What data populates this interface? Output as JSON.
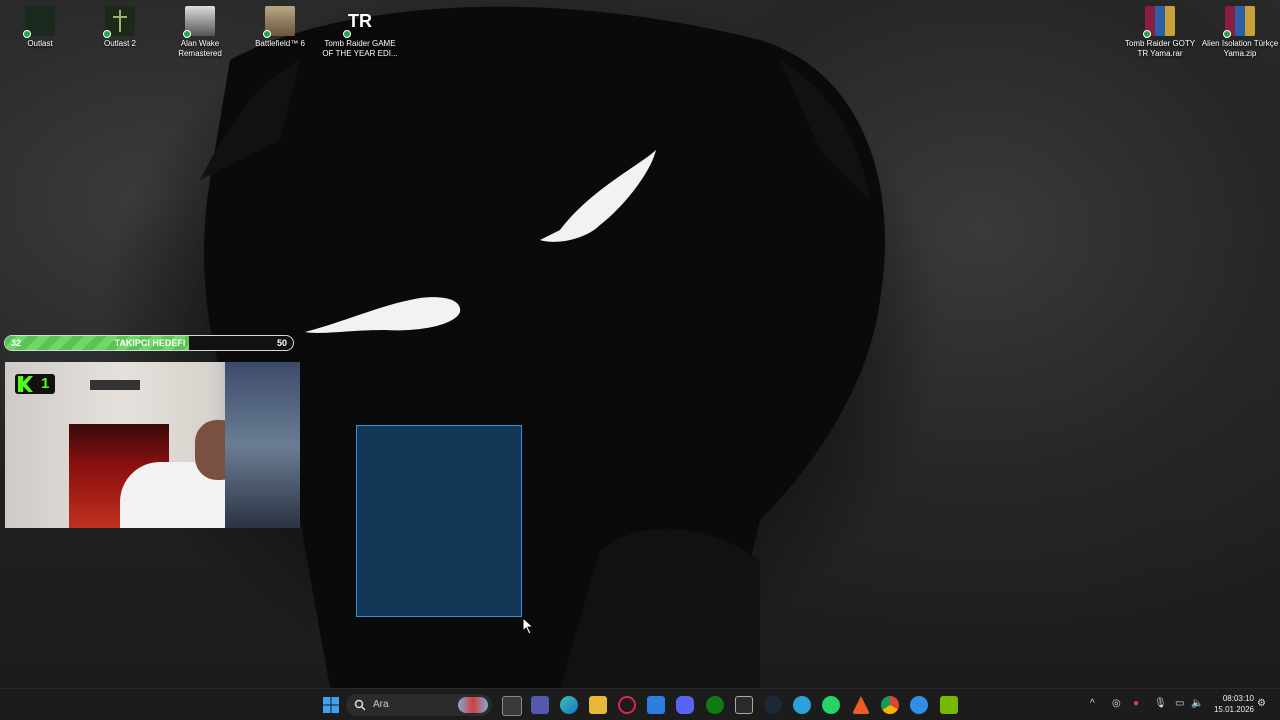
{
  "desktop_icons_left": [
    {
      "label": "Outlast",
      "icon": "outlast-icon"
    },
    {
      "label": "Outlast 2",
      "icon": "outlast-2-icon"
    },
    {
      "label": "Alan Wake Remastered",
      "icon": "alan-wake-icon"
    },
    {
      "label": "Battlefield™ 6",
      "icon": "battlefield-icon"
    },
    {
      "label": "Tomb Raider GAME OF THE YEAR EDI...",
      "icon": "tomb-raider-icon",
      "glyph": "TR"
    }
  ],
  "desktop_icons_right": [
    {
      "label": "Tomb Raider GOTY TR Yama.rar",
      "icon": "winrar-archive-icon"
    },
    {
      "label": "Alien Isolation Türkçe Yama.zip",
      "icon": "winrar-archive-icon"
    }
  ],
  "follower_goal": {
    "current": "32",
    "title": "TAKIPCI HEDEFI",
    "target": "50",
    "progress": 0.64,
    "fill_color": "#5fcd59"
  },
  "webcam_overlay": {
    "badge": "1"
  },
  "taskbar": {
    "search_placeholder": "Ara",
    "pinned": [
      "windows-start-icon",
      "search-icon",
      "news-widget-icon",
      "task-view-icon",
      "teams-icon",
      "edge-icon",
      "file-explorer-icon",
      "opera-gx-icon",
      "microsoft-store-icon",
      "discord-icon",
      "xbox-icon",
      "epic-games-icon",
      "steam-icon",
      "telegram-icon",
      "whatsapp-icon",
      "brave-icon",
      "chrome-icon",
      "browser-icon",
      "nvidia-icon"
    ],
    "clock_time": "08:03:10",
    "clock_date": "15.01.2026"
  }
}
